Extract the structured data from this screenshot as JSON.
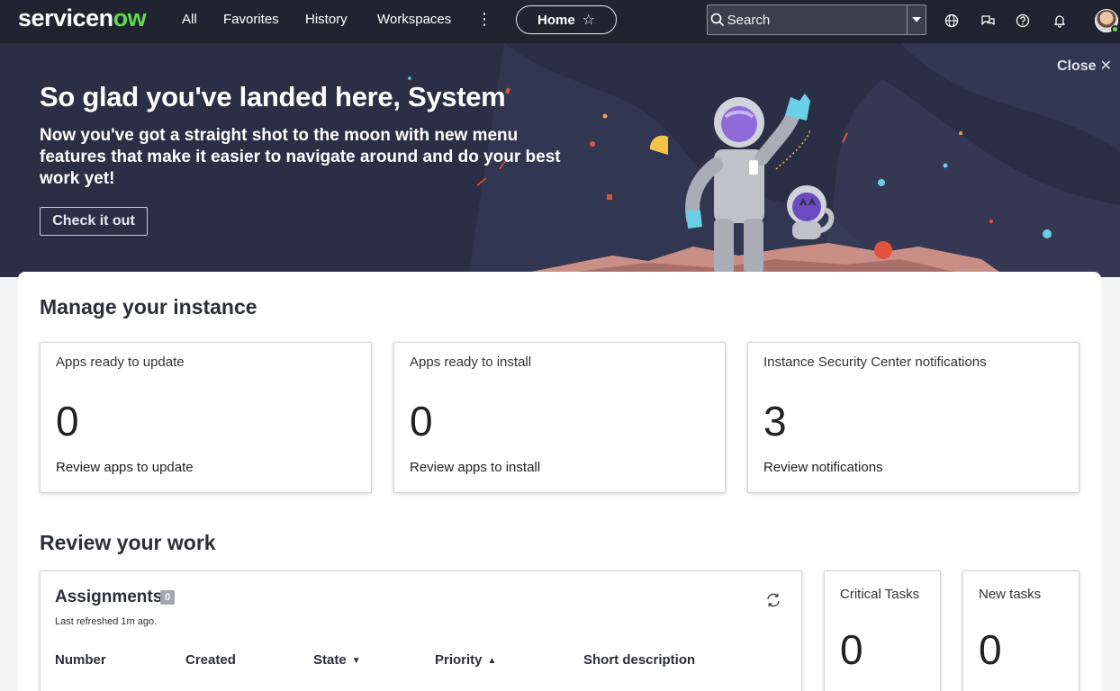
{
  "topnav": {
    "logo_text_a": "servicen",
    "logo_text_b": "ow",
    "items": [
      "All",
      "Favorites",
      "History",
      "Workspaces"
    ],
    "home_label": "Home",
    "search_placeholder": "Search"
  },
  "hero": {
    "title": "So glad you've landed here, System",
    "subtitle": "Now you've got a straight shot to the moon with new menu features that make it easier to navigate around and do your best work yet!",
    "button_label": "Check it out",
    "close_label": "Close"
  },
  "manage": {
    "title": "Manage your instance",
    "cards": [
      {
        "title": "Apps ready to update",
        "count": "0",
        "link": "Review apps to update"
      },
      {
        "title": "Apps ready to install",
        "count": "0",
        "link": "Review apps to install"
      },
      {
        "title": "Instance Security Center notifications",
        "count": "3",
        "link": "Review notifications"
      }
    ]
  },
  "review": {
    "title": "Review your work",
    "assignments": {
      "title": "Assignments",
      "badge": "0",
      "refreshed": "Last refreshed 1m ago.",
      "columns": [
        "Number",
        "Created",
        "State",
        "Priority",
        "Short description"
      ]
    },
    "small_cards": [
      {
        "title": "Critical Tasks",
        "count": "0"
      },
      {
        "title": "New tasks",
        "count": "0"
      }
    ]
  }
}
